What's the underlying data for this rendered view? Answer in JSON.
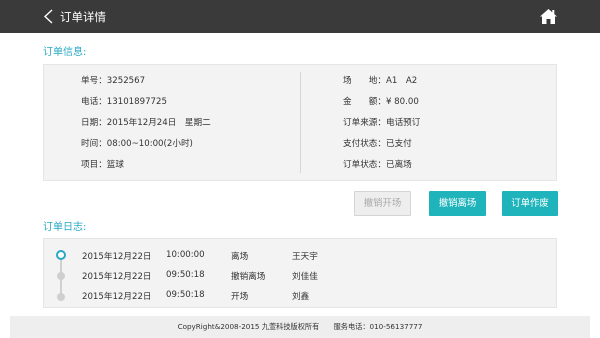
{
  "header": {
    "title": "订单详情",
    "back_icon": "chevron-left-icon",
    "home_icon": "home-icon"
  },
  "order_info": {
    "title": "订单信息:",
    "left": [
      {
        "label": "单号：",
        "value": "3252567"
      },
      {
        "label": "电话：",
        "value": "13101897725"
      },
      {
        "label": "日期：",
        "value": "2015年12月24日　星期二"
      },
      {
        "label": "时间：",
        "value": "08:00~10:00(2小时)"
      },
      {
        "label": "项目：",
        "value": "篮球"
      }
    ],
    "right": [
      {
        "label": "场　　地：",
        "value": "A1　A2"
      },
      {
        "label": "金　　额：",
        "value": "¥ 80.00"
      },
      {
        "label": "订单来源：",
        "value": "电话预订"
      },
      {
        "label": "支付状态：",
        "value": "已支付"
      },
      {
        "label": "订单状态：",
        "value": "已离场"
      }
    ]
  },
  "actions": {
    "undo_enter": "撤销开场",
    "undo_leave": "撤销离场",
    "void_order": "订单作废"
  },
  "order_log": {
    "title": "订单日志:",
    "entries": [
      {
        "date": "2015年12月22日",
        "time": "10:00:00",
        "action": "离场",
        "user": "王天宇"
      },
      {
        "date": "2015年12月22日",
        "time": "09:50:18",
        "action": "撤销离场",
        "user": "刘佳佳"
      },
      {
        "date": "2015年12月22日",
        "time": "09:50:18",
        "action": "开场",
        "user": "刘鑫"
      }
    ]
  },
  "footer": {
    "copyright": "CopyRight&2008-2015 九萱科技版权所有",
    "service_phone": "服务电话：010-56137777"
  },
  "colors": {
    "header_bg": "#3a3a3a",
    "accent": "#27a9c4",
    "button_primary": "#1fb4bb",
    "panel_bg": "#f3f3f3"
  }
}
